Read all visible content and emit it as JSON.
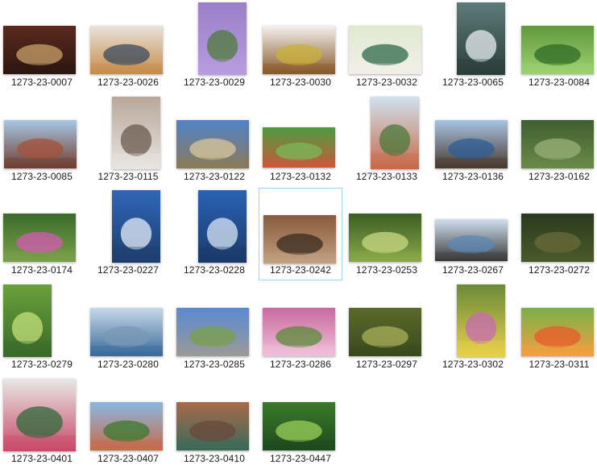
{
  "files": [
    {
      "name": "1273-23-0007",
      "icon": "image-thumbnail",
      "colors": [
        "#5a2a1e",
        "#c9a06a",
        "#2c1710"
      ]
    },
    {
      "name": "1273-23-0026",
      "icon": "image-thumbnail",
      "colors": [
        "#e9e3dc",
        "#3b4a5e",
        "#c78c4a"
      ]
    },
    {
      "name": "1273-23-0029",
      "icon": "image-thumbnail",
      "colors": [
        "#9a7fc8",
        "#4d7a3a",
        "#b89be0"
      ]
    },
    {
      "name": "1273-23-0030",
      "icon": "image-thumbnail",
      "colors": [
        "#f3f1ee",
        "#c9b23a",
        "#8a5a2a"
      ]
    },
    {
      "name": "1273-23-0032",
      "icon": "image-thumbnail",
      "colors": [
        "#dfe9cf",
        "#2e6a4a",
        "#f2efe9"
      ]
    },
    {
      "name": "1273-23-0065",
      "icon": "image-thumbnail",
      "colors": [
        "#5d7a7a",
        "#e8eef0",
        "#2a3f3a"
      ]
    },
    {
      "name": "1273-23-0084",
      "icon": "image-thumbnail",
      "colors": [
        "#5f9a3c",
        "#2d6a24",
        "#9fd070"
      ]
    },
    {
      "name": "1273-23-0085",
      "icon": "image-thumbnail",
      "colors": [
        "#a8c6e4",
        "#a4523a",
        "#6f4030"
      ]
    },
    {
      "name": "1273-23-0115",
      "icon": "image-thumbnail",
      "colors": [
        "#b8a89a",
        "#6a5a4e",
        "#e8e4e0"
      ]
    },
    {
      "name": "1273-23-0122",
      "icon": "image-thumbnail",
      "colors": [
        "#4f82c8",
        "#d9c79a",
        "#8a7a5a"
      ]
    },
    {
      "name": "1273-23-0132",
      "icon": "image-thumbnail",
      "colors": [
        "#4e9a3e",
        "#7ab95a",
        "#c85a3a"
      ]
    },
    {
      "name": "1273-23-0133",
      "icon": "image-thumbnail",
      "colors": [
        "#cfe2ee",
        "#4a7a3a",
        "#c86a4a"
      ]
    },
    {
      "name": "1273-23-0136",
      "icon": "image-thumbnail",
      "colors": [
        "#a8c4e4",
        "#2e5e96",
        "#4a3a2e"
      ]
    },
    {
      "name": "1273-23-0162",
      "icon": "image-thumbnail",
      "colors": [
        "#3e5e2e",
        "#9ab07a",
        "#6a8a4a"
      ]
    },
    {
      "name": "1273-23-0174",
      "icon": "image-thumbnail",
      "colors": [
        "#3a6a2a",
        "#d65ab2",
        "#7aa04a"
      ]
    },
    {
      "name": "1273-23-0227",
      "icon": "image-thumbnail",
      "colors": [
        "#2f66b8",
        "#e4eef8",
        "#1e3e6e"
      ]
    },
    {
      "name": "1273-23-0228",
      "icon": "image-thumbnail",
      "colors": [
        "#2a62b4",
        "#d8e6f6",
        "#1a3a6a"
      ]
    },
    {
      "name": "1273-23-0242",
      "icon": "image-thumbnail",
      "colors": [
        "#8a5a3e",
        "#3a2a1e",
        "#c0a080"
      ]
    },
    {
      "name": "1273-23-0253",
      "icon": "image-thumbnail",
      "colors": [
        "#3a5e22",
        "#c8d884",
        "#8aa84a"
      ]
    },
    {
      "name": "1273-23-0267",
      "icon": "image-thumbnail",
      "colors": [
        "#cfe0ee",
        "#5e88b4",
        "#3a3a3a"
      ]
    },
    {
      "name": "1273-23-0272",
      "icon": "image-thumbnail",
      "colors": [
        "#2a3a1e",
        "#6a6a3a",
        "#4a5a2a"
      ]
    },
    {
      "name": "1273-23-0279",
      "icon": "image-thumbnail",
      "colors": [
        "#6aa03a",
        "#c4e07a",
        "#3a6a2a"
      ]
    },
    {
      "name": "1273-23-0280",
      "icon": "image-thumbnail",
      "colors": [
        "#c6d8ea",
        "#7a9ab4",
        "#3a6a9a"
      ]
    },
    {
      "name": "1273-23-0285",
      "icon": "image-thumbnail",
      "colors": [
        "#5a8ad0",
        "#7aa04a",
        "#9a9a9a"
      ]
    },
    {
      "name": "1273-23-0286",
      "icon": "image-thumbnail",
      "colors": [
        "#c86aa0",
        "#5a8a3a",
        "#f0c0d8"
      ]
    },
    {
      "name": "1273-23-0297",
      "icon": "image-thumbnail",
      "colors": [
        "#5a6a2a",
        "#aab05a",
        "#3a4a1e"
      ]
    },
    {
      "name": "1273-23-0302",
      "icon": "image-thumbnail",
      "colors": [
        "#6a8a3a",
        "#c86ab4",
        "#e8d04a"
      ]
    },
    {
      "name": "1273-23-0311",
      "icon": "image-thumbnail",
      "colors": [
        "#7ab04a",
        "#e85a2a",
        "#f4a040"
      ]
    },
    {
      "name": "1273-23-0401",
      "icon": "image-thumbnail",
      "colors": [
        "#e8e8e4",
        "#2e6a3a",
        "#c84a6a"
      ]
    },
    {
      "name": "1273-23-0407",
      "icon": "image-thumbnail",
      "colors": [
        "#8ab8e0",
        "#3a7a2e",
        "#c86a4a"
      ]
    },
    {
      "name": "1273-23-0410",
      "icon": "image-thumbnail",
      "colors": [
        "#a86a4a",
        "#6a4a3a",
        "#3a6a5a"
      ]
    },
    {
      "name": "1273-23-0447",
      "icon": "image-thumbnail",
      "colors": [
        "#3a7a2a",
        "#9ad05a",
        "#1e4a1e"
      ]
    }
  ],
  "selected_index": 17,
  "colors": {
    "selection_border": "#99d1ff",
    "label_text": "#1a1a1a"
  }
}
